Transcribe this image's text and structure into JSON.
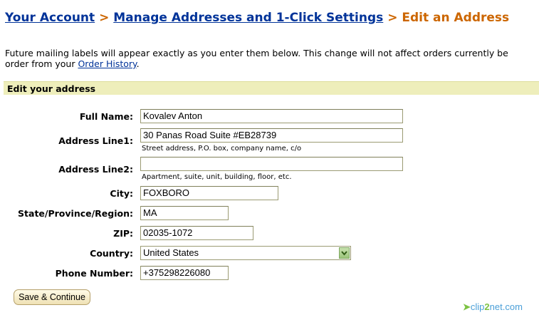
{
  "breadcrumb": {
    "your_account": "Your Account",
    "sep1": ">",
    "manage": "Manage Addresses and 1-Click Settings",
    "sep2": ">",
    "current": "Edit an Address"
  },
  "intro": {
    "line1": "Future mailing labels will appear exactly as you enter them below. This change will not affect orders currently be",
    "line2_prefix": "order from your ",
    "order_history_link": "Order History",
    "line2_suffix": "."
  },
  "section_title": "Edit your address",
  "form": {
    "full_name": {
      "label": "Full Name:",
      "value": "Kovalev Anton"
    },
    "address1": {
      "label": "Address Line1:",
      "value": "30 Panas Road Suite #EB28739",
      "hint": "Street address, P.O. box, company name, c/o"
    },
    "address2": {
      "label": "Address Line2:",
      "value": "",
      "hint": "Apartment, suite, unit, building, floor, etc."
    },
    "city": {
      "label": "City:",
      "value": "FOXBORO"
    },
    "state": {
      "label": "State/Province/Region:",
      "value": "MA"
    },
    "zip": {
      "label": "ZIP:",
      "value": "02035-1072"
    },
    "country": {
      "label": "Country:",
      "value": "United States"
    },
    "phone": {
      "label": "Phone Number:",
      "value": "+375298226080"
    }
  },
  "save_button": "Save & Continue",
  "watermark": {
    "prefix": "clip",
    "two": "2",
    "suffix": "net.com"
  },
  "colors": {
    "link": "#003399",
    "accent": "#cc6600",
    "section_bg": "#eeeebb"
  }
}
